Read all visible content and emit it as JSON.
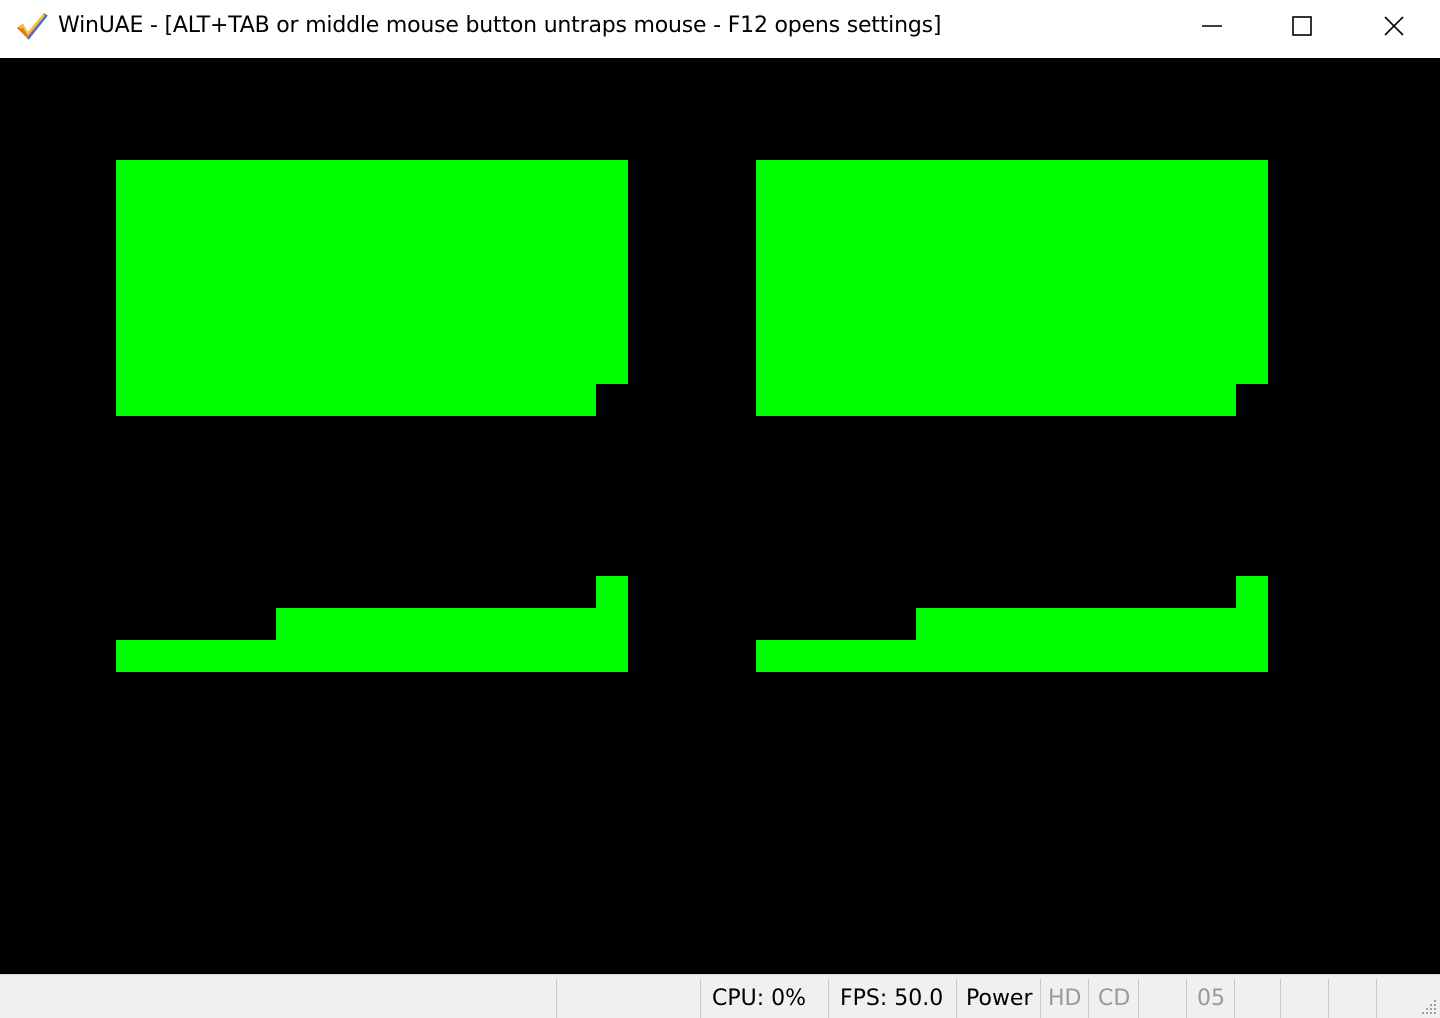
{
  "window": {
    "title": "WinUAE - [ALT+TAB or middle mouse button untraps mouse - F12 opens settings]",
    "icon": "winuae-checkmark-icon"
  },
  "title_buttons": {
    "minimize": "minimize-icon",
    "maximize": "maximize-icon",
    "close": "close-icon"
  },
  "display": {
    "background_color": "#000000",
    "graphics_color": "#00ff00"
  },
  "status_bar": {
    "cpu": "CPU: 0%",
    "fps": "FPS: 50.0",
    "power": "Power",
    "hd": "HD",
    "cd": "CD",
    "drive": "05"
  }
}
